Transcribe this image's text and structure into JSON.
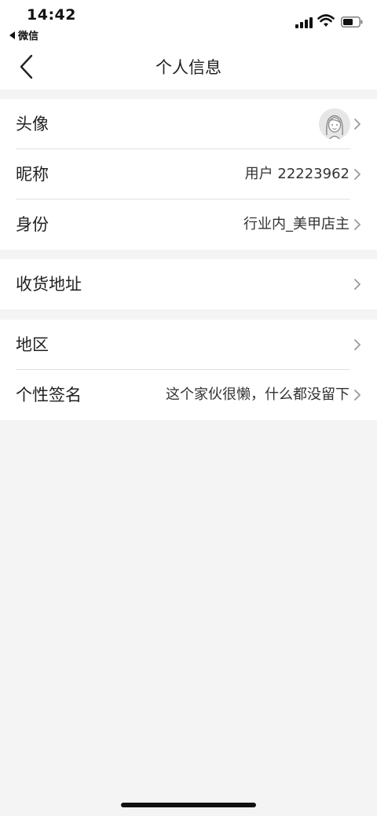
{
  "status_bar": {
    "time": "14:42",
    "back_app_label": "微信"
  },
  "nav": {
    "title": "个人信息"
  },
  "groups": [
    {
      "rows": [
        {
          "label": "头像",
          "value": ""
        },
        {
          "label": "昵称",
          "value": "用户 22223962"
        },
        {
          "label": "身份",
          "value": "行业内_美甲店主"
        }
      ]
    },
    {
      "rows": [
        {
          "label": "收货地址",
          "value": ""
        }
      ]
    },
    {
      "rows": [
        {
          "label": "地区",
          "value": ""
        },
        {
          "label": "个性签名",
          "value": "这个家伙很懒，什么都没留下"
        }
      ]
    }
  ],
  "icons": {
    "back": "chevron-left-icon",
    "row_arrow": "chevron-right-icon",
    "avatar": "avatar-icon"
  }
}
